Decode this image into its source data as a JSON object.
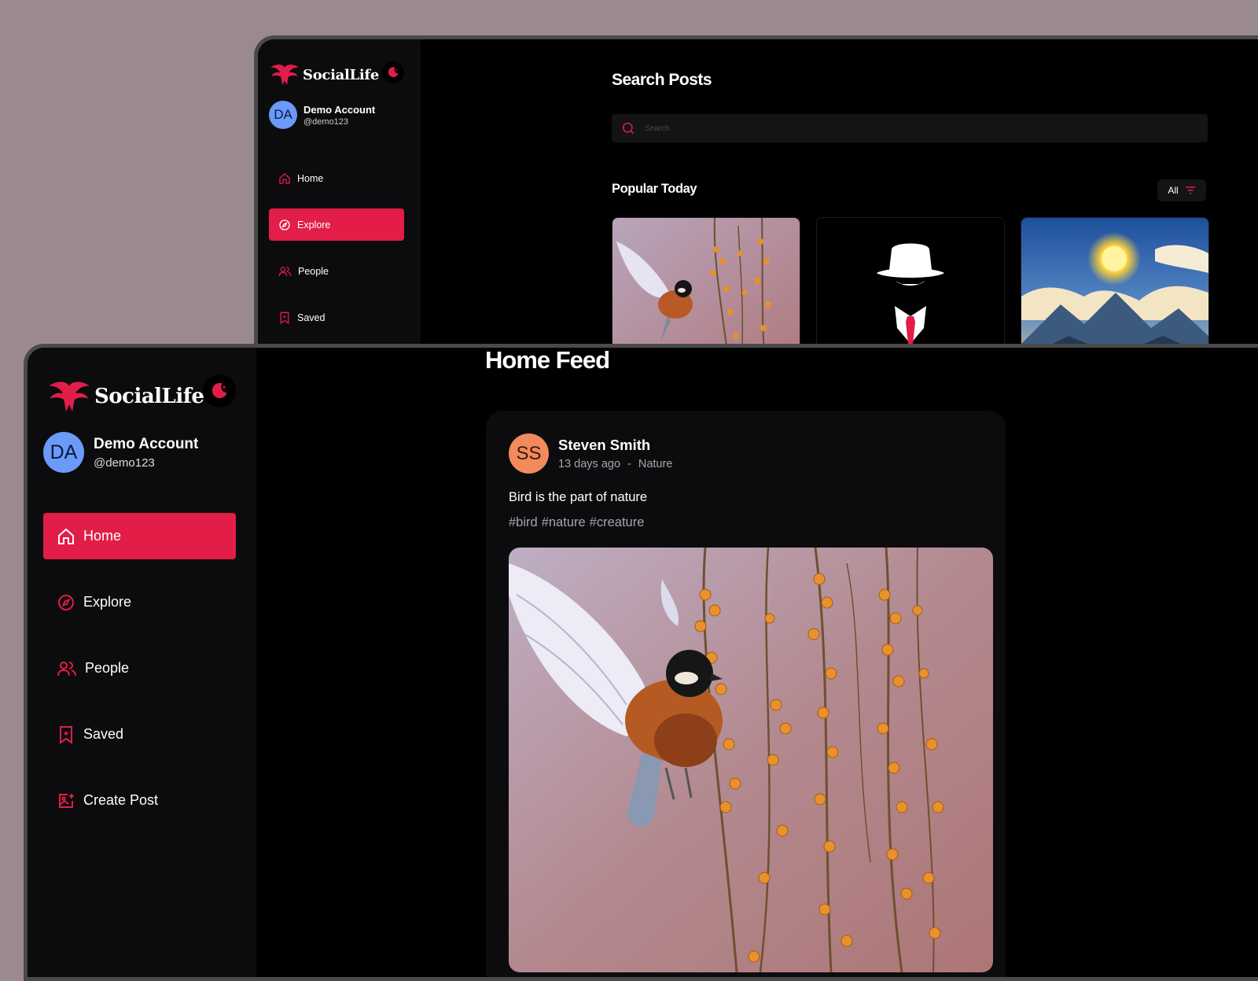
{
  "brand": {
    "name": "SocialLife",
    "accent": "#e11d48",
    "background": "#9a8a8e"
  },
  "back_window": {
    "user": {
      "initials": "DA",
      "name": "Demo Account",
      "handle": "@demo123"
    },
    "nav": [
      {
        "label": "Home",
        "icon": "home-icon",
        "active": false
      },
      {
        "label": "Explore",
        "icon": "compass-icon",
        "active": true
      },
      {
        "label": "People",
        "icon": "people-icon",
        "active": false
      },
      {
        "label": "Saved",
        "icon": "bookmark-icon",
        "active": false
      }
    ],
    "page_title": "Search Posts",
    "search": {
      "placeholder": "Search",
      "value": ""
    },
    "section_title": "Popular Today",
    "filter": {
      "label": "All",
      "icon": "filter-icon"
    },
    "thumbnails": [
      "bird-photo",
      "hat-figure-illustration",
      "sun-mountain-painting"
    ]
  },
  "front_window": {
    "user": {
      "initials": "DA",
      "name": "Demo Account",
      "handle": "@demo123"
    },
    "nav": [
      {
        "label": "Home",
        "icon": "home-icon",
        "active": true
      },
      {
        "label": "Explore",
        "icon": "compass-icon",
        "active": false
      },
      {
        "label": "People",
        "icon": "people-icon",
        "active": false
      },
      {
        "label": "Saved",
        "icon": "bookmark-icon",
        "active": false
      },
      {
        "label": "Create Post",
        "icon": "create-post-icon",
        "active": false
      }
    ],
    "page_title": "Home Feed",
    "post": {
      "author_initials": "SS",
      "author": "Steven Smith",
      "time": "13 days ago",
      "separator": "-",
      "category": "Nature",
      "caption": "Bird is the part of nature",
      "tags": [
        "#bird",
        "#nature",
        "#creature"
      ]
    }
  }
}
